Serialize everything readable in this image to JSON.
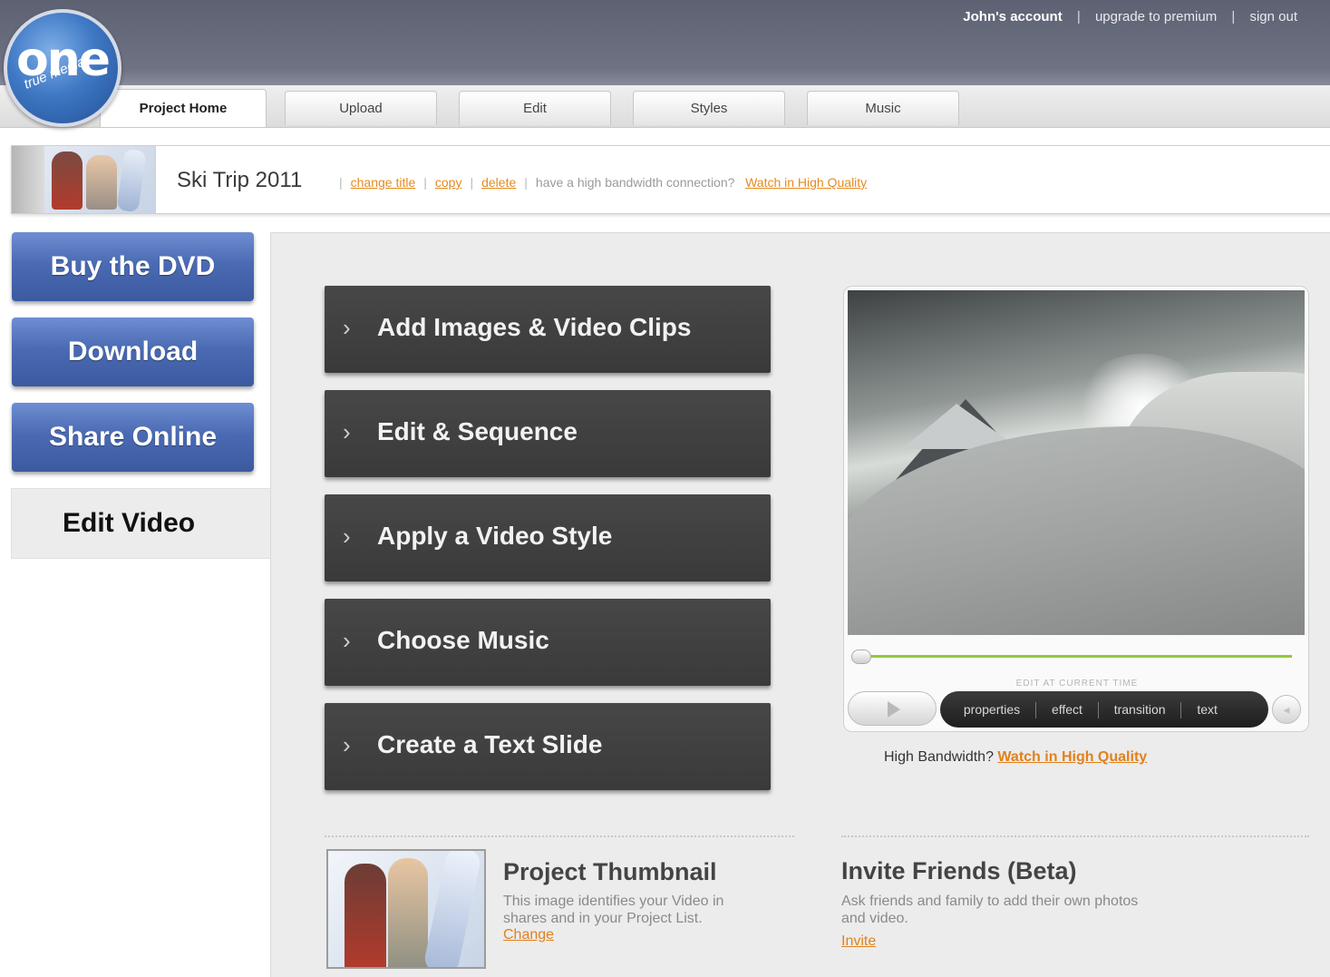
{
  "header": {
    "logo_main": "one",
    "logo_sub": "true media",
    "account": "John's account",
    "upgrade": "upgrade to premium",
    "signout": "sign out",
    "separator": "|",
    "tabs": [
      "Project Home",
      "Upload",
      "Edit",
      "Styles",
      "Music"
    ],
    "active_tab": "Project Home"
  },
  "project": {
    "title": "Ski Trip 2011",
    "change_title": "change title",
    "copy": "copy",
    "delete": "delete",
    "bandwidth_note": "have a high bandwidth connection?",
    "watch_hq": "Watch in High Quality"
  },
  "sidebar": {
    "buy_dvd": "Buy the DVD",
    "download": "Download",
    "share_online": "Share Online",
    "edit_video": "Edit Video"
  },
  "steps": [
    "Add Images & Video Clips",
    "Edit & Sequence",
    "Apply a Video Style",
    "Choose Music",
    "Create a Text Slide"
  ],
  "player": {
    "edit_caption": "EDIT AT CURRENT TIME",
    "controls": [
      "properties",
      "effect",
      "transition",
      "text"
    ],
    "hq_prefix": "High Bandwidth?",
    "hq_link": "Watch in High Quality",
    "progress_fraction": 0.0,
    "colors": {
      "progress_track": "#93c93b",
      "link": "#e2801c"
    }
  },
  "thumbnail_section": {
    "title": "Project Thumbnail",
    "desc_line1": "This image identifies your Video in",
    "desc_line2": "shares and in your Project List.",
    "link": "Change"
  },
  "invite_section": {
    "title": "Invite Friends (Beta)",
    "desc_line1": "Ask friends and family to add their own photos",
    "desc_line2": "and video.",
    "link": "Invite"
  }
}
